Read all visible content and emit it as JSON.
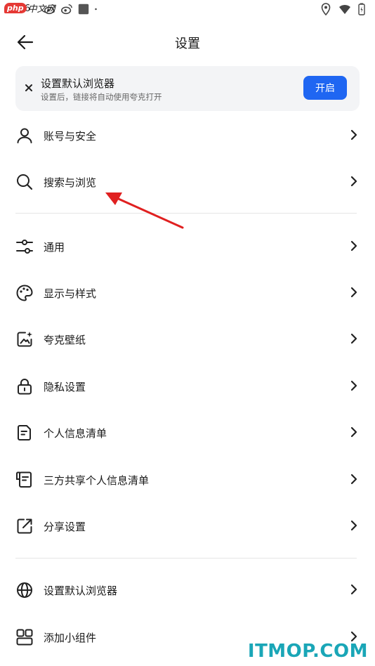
{
  "status_bar": {
    "time": "1:36"
  },
  "overlay": {
    "logo_badge": "php",
    "logo_text": "中文网",
    "watermark": "ITMOP.COM"
  },
  "header": {
    "title": "设置"
  },
  "banner": {
    "title": "设置默认浏览器",
    "subtitle": "设置后，链接将自动使用夸克打开",
    "button": "开启"
  },
  "menu": {
    "account": "账号与安全",
    "search": "搜索与浏览",
    "general": "通用",
    "display": "显示与样式",
    "wallpaper": "夸克壁纸",
    "privacy": "隐私设置",
    "personal_info": "个人信息清单",
    "third_party": "三方共享个人信息清单",
    "share": "分享设置",
    "default_browser": "设置默认浏览器",
    "widget": "添加小组件"
  },
  "colors": {
    "accent": "#1f66f2",
    "annotation_arrow": "#e02020"
  }
}
